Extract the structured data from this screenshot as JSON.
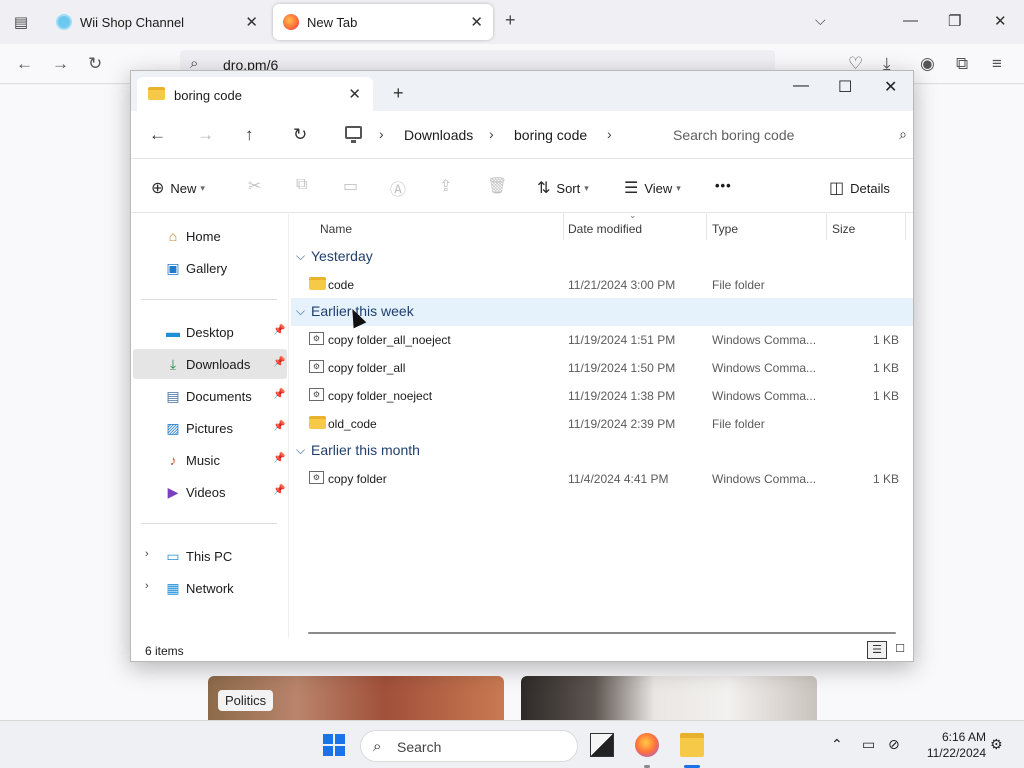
{
  "browser": {
    "tabs": [
      {
        "title": "Wii Shop Channel"
      },
      {
        "title": "New Tab"
      }
    ],
    "url": "dro.pm/6"
  },
  "news": {
    "badge": "Politics"
  },
  "explorer": {
    "tab_title": "boring code",
    "breadcrumb": [
      "Downloads",
      "boring code"
    ],
    "search_placeholder": "Search boring code",
    "toolbar": {
      "new_label": "New",
      "sort_label": "Sort",
      "view_label": "View",
      "more_label": "•••",
      "details_label": "Details"
    },
    "sidebar": {
      "home": "Home",
      "gallery": "Gallery",
      "desktop": "Desktop",
      "downloads": "Downloads",
      "documents": "Documents",
      "pictures": "Pictures",
      "music": "Music",
      "videos": "Videos",
      "thispc": "This PC",
      "network": "Network"
    },
    "columns": {
      "name": "Name",
      "date": "Date modified",
      "type": "Type",
      "size": "Size"
    },
    "groups": {
      "yesterday": {
        "label": "Yesterday",
        "rows": [
          {
            "name": "code",
            "date": "11/21/2024 3:00 PM",
            "type": "File folder",
            "size": ""
          }
        ]
      },
      "week": {
        "label": "Earlier this week",
        "rows": [
          {
            "name": "copy folder_all_noeject",
            "date": "11/19/2024 1:51 PM",
            "type": "Windows Comma...",
            "size": "1 KB"
          },
          {
            "name": "copy folder_all",
            "date": "11/19/2024 1:50 PM",
            "type": "Windows Comma...",
            "size": "1 KB"
          },
          {
            "name": "copy folder_noeject",
            "date": "11/19/2024 1:38 PM",
            "type": "Windows Comma...",
            "size": "1 KB"
          },
          {
            "name": "old_code",
            "date": "11/19/2024 2:39 PM",
            "type": "File folder",
            "size": ""
          }
        ]
      },
      "month": {
        "label": "Earlier this month",
        "rows": [
          {
            "name": "copy folder",
            "date": "11/4/2024 4:41 PM",
            "type": "Windows Comma...",
            "size": "1 KB"
          }
        ]
      }
    },
    "status": "6 items"
  },
  "taskbar": {
    "search_label": "Search",
    "time": "6:16 AM",
    "date": "11/22/2024"
  }
}
